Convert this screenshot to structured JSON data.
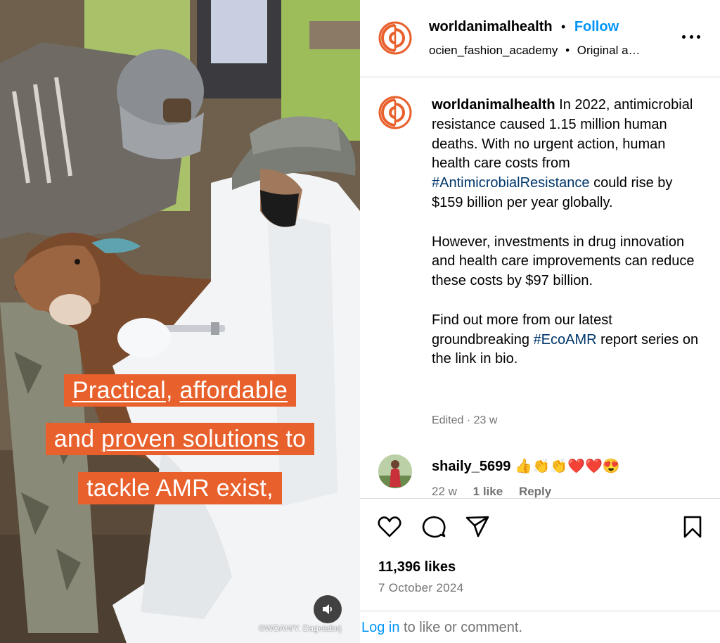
{
  "media": {
    "caption_lines": [
      {
        "parts": [
          {
            "text": "Practical",
            "u": true
          },
          {
            "text": ", ",
            "u": false
          },
          {
            "text": "affordable",
            "u": true
          }
        ]
      },
      {
        "parts": [
          {
            "text": "and ",
            "u": false
          },
          {
            "text": "proven solutions",
            "u": true
          },
          {
            "text": " to",
            "u": false
          }
        ]
      },
      {
        "parts": [
          {
            "text": "tackle AMR exist,",
            "u": false
          }
        ]
      }
    ],
    "credit": "©WOAH/Y. Dagvadorj",
    "accent_color": "#e8602c",
    "sound_icon": "speaker-icon"
  },
  "header": {
    "username": "worldanimalhealth",
    "separator": "•",
    "follow_label": "Follow",
    "collaborator": "ocien_fashion_academy",
    "audio": "Original a…",
    "more_icon": "more-options-icon"
  },
  "post": {
    "username": "worldanimalhealth",
    "paragraph1_a": "In 2022, antimicrobial resistance caused 1.15 million human deaths. With no urgent action, human health care costs from ",
    "paragraph1_tag": "#AntimicrobialResistance",
    "paragraph1_b": " could rise by $159 billion per year globally.",
    "paragraph2": "However, investments in drug innovation and health care improvements can reduce these costs by $97 billion.",
    "paragraph3_a": "Find out more from our latest groundbreaking ",
    "paragraph3_tag": "#EcoAMR",
    "paragraph3_b": " report series on the link in bio.",
    "edited": "Edited · 23 w"
  },
  "comment": {
    "username": "shaily_5699",
    "text": "👍👏👏❤️❤️😍",
    "time": "22 w",
    "likes": "1 like",
    "reply": "Reply"
  },
  "actions": {
    "icons": [
      "heart-icon",
      "comment-icon",
      "share-icon",
      "bookmark-icon"
    ],
    "likes": "11,396 likes",
    "date": "7 October 2024"
  },
  "login": {
    "link": "Log in",
    "rest": " to like or comment."
  },
  "colors": {
    "brand_orange": "#e8602c",
    "link_blue": "#0095f6",
    "hashtag_blue": "#00376b",
    "muted": "#737373"
  }
}
